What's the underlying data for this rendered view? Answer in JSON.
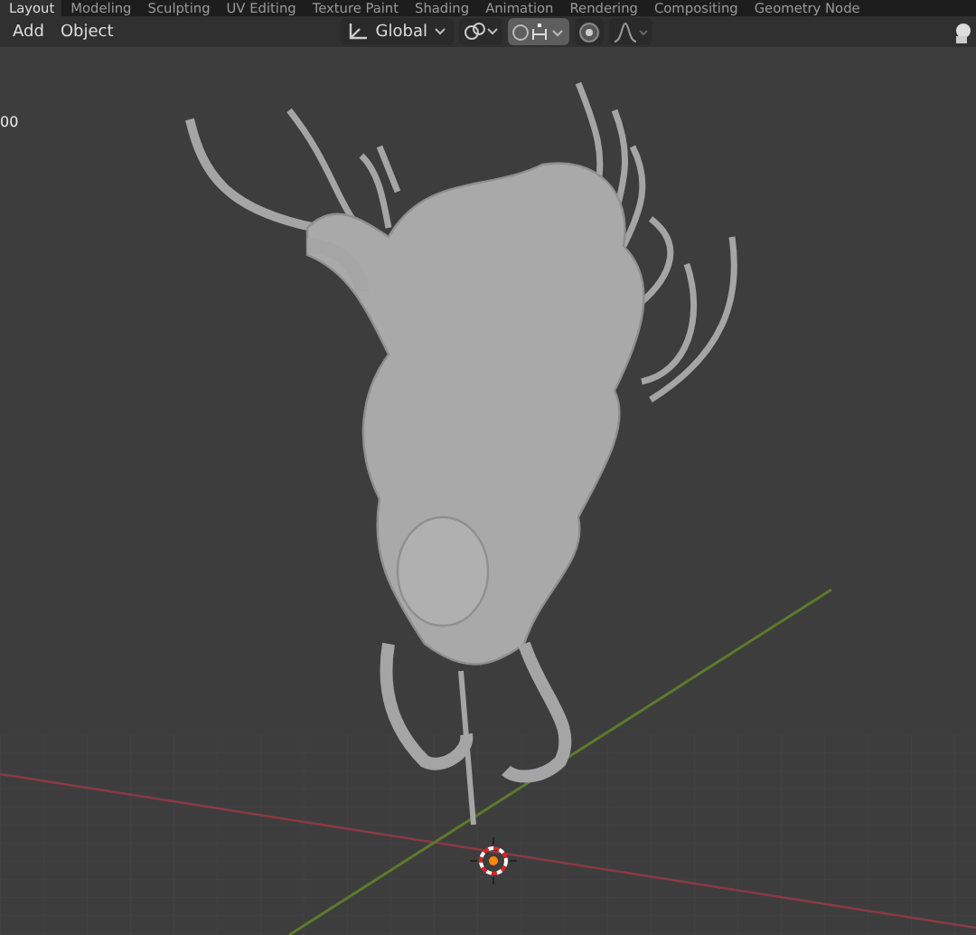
{
  "workspace_tabs": [
    {
      "label": "Layout",
      "selected": true
    },
    {
      "label": "Modeling",
      "selected": false
    },
    {
      "label": "Sculpting",
      "selected": false
    },
    {
      "label": "UV Editing",
      "selected": false
    },
    {
      "label": "Texture Paint",
      "selected": false
    },
    {
      "label": "Shading",
      "selected": false
    },
    {
      "label": "Animation",
      "selected": false
    },
    {
      "label": "Rendering",
      "selected": false
    },
    {
      "label": "Compositing",
      "selected": false
    },
    {
      "label": "Geometry Node",
      "selected": false
    }
  ],
  "header": {
    "menus": [
      "Add",
      "Object"
    ],
    "orientation": "Global",
    "snap_active": true,
    "proportional_active": false
  },
  "viewport": {
    "overlay_text": "00"
  }
}
